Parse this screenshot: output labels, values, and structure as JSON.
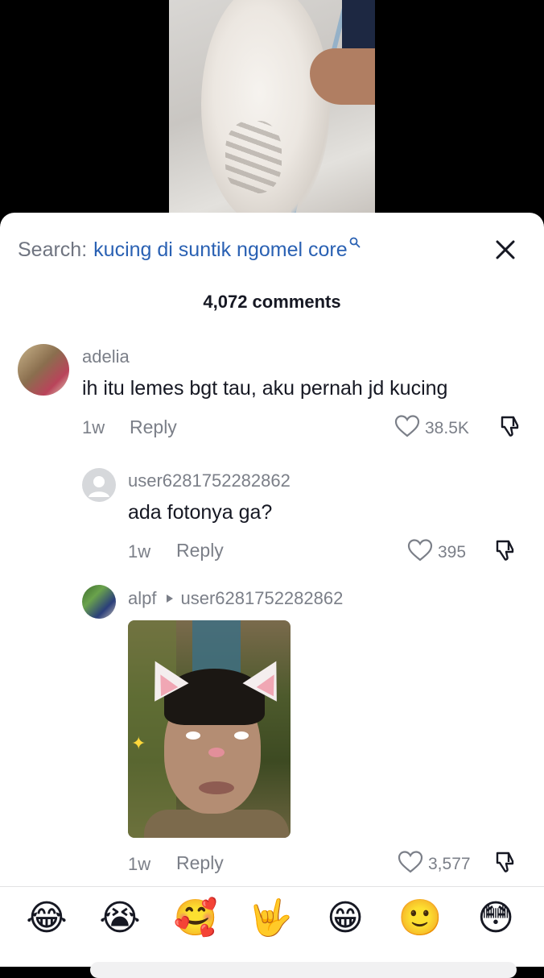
{
  "search": {
    "prefix": "Search:",
    "query": "kucing di suntik ngomel core",
    "icon": "search-icon"
  },
  "close_icon": "close-icon",
  "comments_count": "4,072 comments",
  "comments": [
    {
      "username": "adelia",
      "text": "ih itu lemes bgt tau, aku pernah jd kucing",
      "age": "1w",
      "reply_label": "Reply",
      "likes": "38.5K"
    },
    {
      "username": "user6281752282862",
      "text": "ada fotonya ga?",
      "age": "1w",
      "reply_label": "Reply",
      "likes": "395"
    },
    {
      "username": "alpf",
      "reply_to": "user6281752282862",
      "age": "1w",
      "reply_label": "Reply",
      "likes": "3,577"
    }
  ],
  "emoji_bar": [
    "😂",
    "😭",
    "🥰",
    "🤟",
    "😁",
    "🙂",
    "😳"
  ],
  "colors": {
    "accent_link": "#2a61b3",
    "muted_text": "#7b7f88",
    "primary_text": "#161823"
  }
}
